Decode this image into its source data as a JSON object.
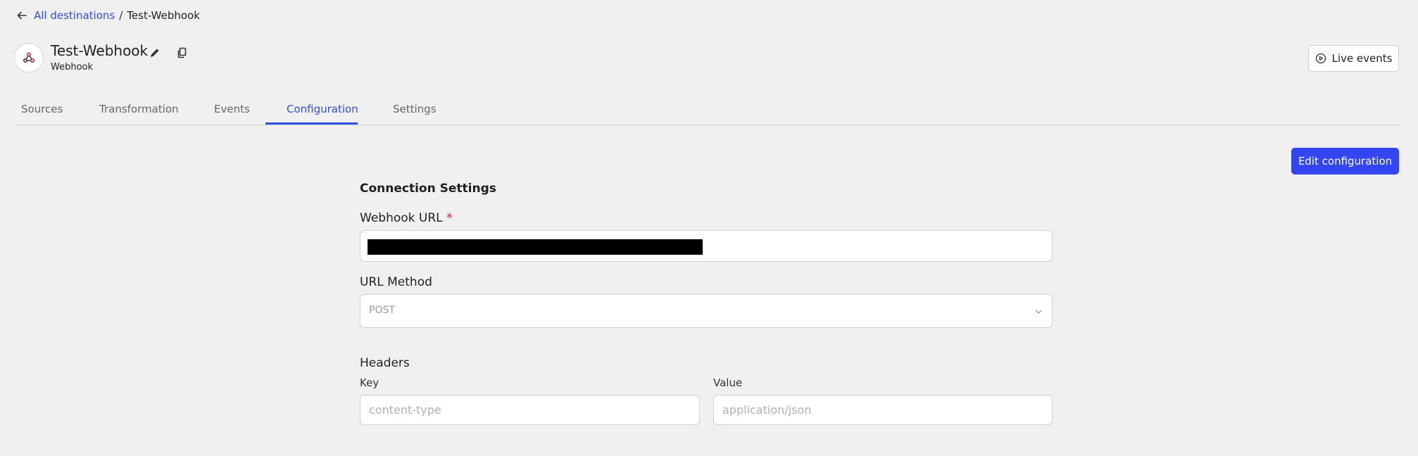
{
  "breadcrumb": {
    "back_icon": "arrow-left-icon",
    "parent": "All destinations",
    "separator": "/",
    "current": "Test-Webhook"
  },
  "header": {
    "title": "Test-Webhook",
    "type": "Webhook",
    "avatar_icon": "webhook-icon",
    "edit_icon": "pencil-icon",
    "copy_icon": "copy-icon",
    "live_events_label": "Live events",
    "live_events_icon": "play-circle-icon"
  },
  "tabs": [
    {
      "label": "Sources",
      "active": false
    },
    {
      "label": "Transformation",
      "active": false
    },
    {
      "label": "Events",
      "active": false
    },
    {
      "label": "Configuration",
      "active": true
    },
    {
      "label": "Settings",
      "active": false
    }
  ],
  "actions": {
    "edit_configuration": "Edit configuration"
  },
  "form": {
    "section_title": "Connection Settings",
    "webhook_url": {
      "label": "Webhook URL",
      "required_mark": "*",
      "value_redacted": true
    },
    "url_method": {
      "label": "URL Method",
      "value": "POST"
    },
    "headers": {
      "label": "Headers",
      "key_label": "Key",
      "value_label": "Value",
      "key_placeholder": "content-type",
      "value_placeholder": "application/json"
    }
  },
  "colors": {
    "accent": "#2f4fe0",
    "primary_button": "#3346f2",
    "required": "#e11d2e"
  }
}
